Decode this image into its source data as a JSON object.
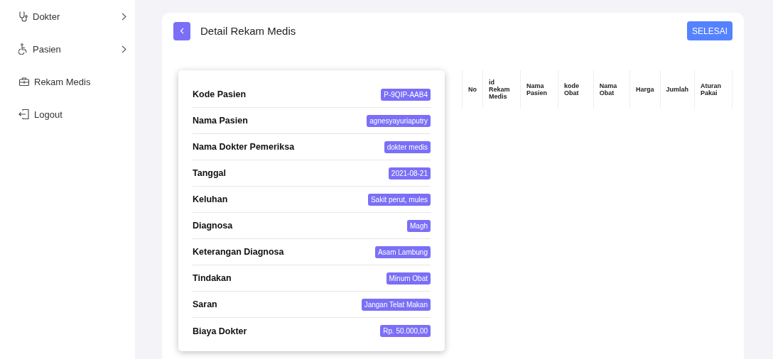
{
  "sidebar": {
    "items": [
      {
        "label": "Dokter",
        "kind": "submenu"
      },
      {
        "label": "Pasien",
        "kind": "submenu"
      },
      {
        "label": "Rekam Medis",
        "kind": "link"
      },
      {
        "label": "Logout",
        "kind": "link"
      }
    ]
  },
  "page": {
    "title": "Detail Rekam Medis",
    "done_button": "SELESAI"
  },
  "details": [
    {
      "label": "Kode Pasien",
      "value": "P-9QIP-AAB4"
    },
    {
      "label": "Nama Pasien",
      "value": "agnesyayuriaputry"
    },
    {
      "label": "Nama Dokter Pemeriksa",
      "value": "dokter medis"
    },
    {
      "label": "Tanggal",
      "value": "2021-08-21"
    },
    {
      "label": "Keluhan",
      "value": "Sakit perut, mules"
    },
    {
      "label": "Diagnosa",
      "value": "Magh"
    },
    {
      "label": "Keterangan Diagnosa",
      "value": "Asam Lambung"
    },
    {
      "label": "Tindakan",
      "value": "Minum Obat"
    },
    {
      "label": "Saran",
      "value": "Jangan Telat Makan"
    },
    {
      "label": "Biaya Dokter",
      "value": "Rp. 50.000,00"
    }
  ],
  "table": {
    "columns": [
      "No",
      "id Rekam Medis",
      "Nama Pasien",
      "kode Obat",
      "Nama Obat",
      "Harga",
      "Jumlah",
      "Aturan Pakai"
    ]
  }
}
